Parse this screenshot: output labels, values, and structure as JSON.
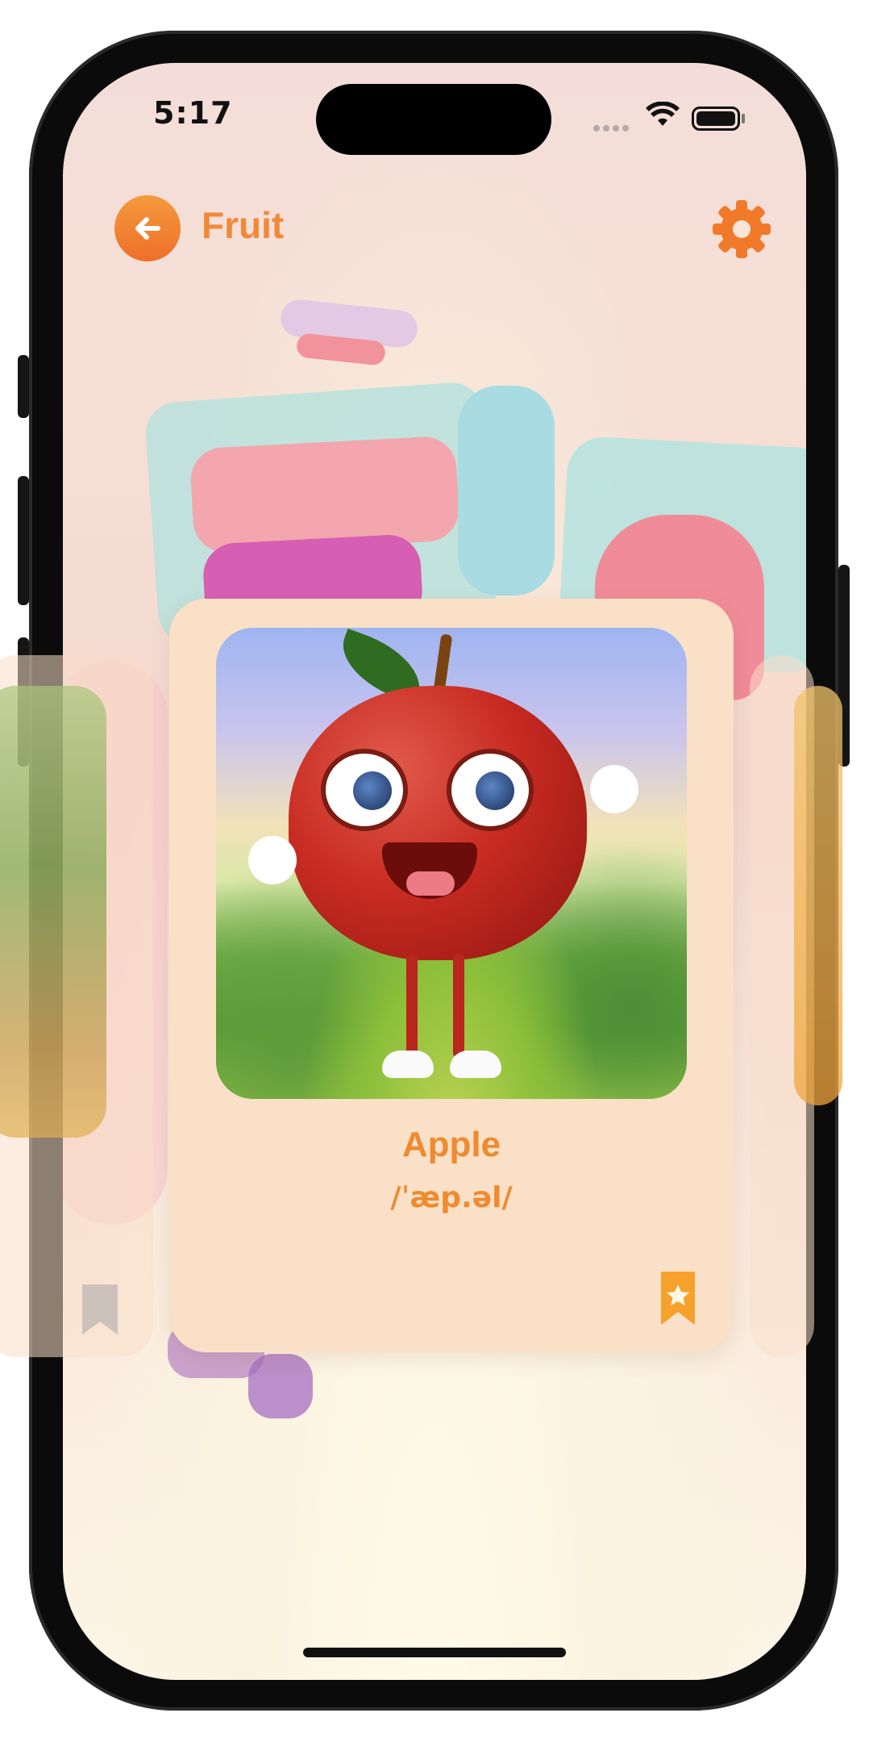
{
  "status_bar": {
    "time": "5:17"
  },
  "nav": {
    "title": "Fruit",
    "back_icon": "arrow-left-icon",
    "settings_icon": "gear-icon"
  },
  "card": {
    "word": "Apple",
    "ipa": "/ˈæp.əl/",
    "bookmark_icon": "bookmark-star-icon"
  },
  "colors": {
    "accent": "#ef8a2f",
    "card_bg": "#f9e0c7"
  }
}
